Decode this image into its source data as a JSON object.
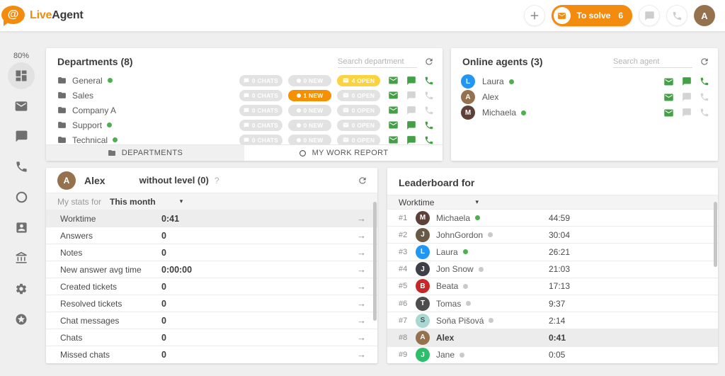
{
  "colors": {
    "brand_orange": "#F28B0E",
    "chip_grey": "#E2E2E2",
    "chip_orange": "#F59100",
    "chip_yellow": "#FBD342",
    "action_green": "#43A047",
    "status_online_green": "#4CAF50",
    "status_away_grey": "#C9C9C9",
    "highlight_row": "#EDEDED",
    "avatar_laura_blue": "#2196F3",
    "avatar_alex_brown": "#96714E",
    "avatar_michaela_darkbrown": "#5D4037",
    "avatar_beata_red": "#C62828",
    "avatar_jane_green": "#2DBE6C"
  },
  "topbar": {
    "logo": {
      "at": "@",
      "live": "Live",
      "agent": "Agent"
    },
    "to_solve": {
      "label": "To solve",
      "count": "6"
    },
    "avatar_initial": "A",
    "icons": [
      "add-circle-icon",
      "mail-icon",
      "chat-icon",
      "phone-icon"
    ]
  },
  "sidebar": {
    "percent": "80%",
    "items": [
      "dashboard",
      "tickets",
      "chats",
      "calls",
      "history",
      "contacts",
      "portal",
      "settings",
      "rewards"
    ]
  },
  "departments_panel": {
    "title": "Departments (8)",
    "search_placeholder": "Search department",
    "rows": [
      {
        "name": "General",
        "status": "online",
        "chats": "0 CHATS",
        "chats_variant": "grey",
        "new": "0 NEW",
        "new_variant": "grey",
        "open": "4 OPEN",
        "open_variant": "yellow",
        "mail": "on",
        "chat": "on",
        "phone": "on"
      },
      {
        "name": "Sales",
        "status": "none",
        "chats": "0 CHATS",
        "chats_variant": "grey",
        "new": "1 NEW",
        "new_variant": "orange",
        "open": "0 OPEN",
        "open_variant": "grey",
        "mail": "on",
        "chat": "off",
        "phone": "off"
      },
      {
        "name": "Company A",
        "status": "none",
        "chats": "0 CHATS",
        "chats_variant": "grey",
        "new": "0 NEW",
        "new_variant": "grey",
        "open": "0 OPEN",
        "open_variant": "grey",
        "mail": "on",
        "chat": "off",
        "phone": "off"
      },
      {
        "name": "Support",
        "status": "online",
        "chats": "0 CHATS",
        "chats_variant": "grey",
        "new": "0 NEW",
        "new_variant": "grey",
        "open": "0 OPEN",
        "open_variant": "grey",
        "mail": "on",
        "chat": "on",
        "phone": "on"
      },
      {
        "name": "Technical",
        "status": "online",
        "chats": "0 CHATS",
        "chats_variant": "grey",
        "new": "0 NEW",
        "new_variant": "grey",
        "open": "0 OPEN",
        "open_variant": "grey",
        "mail": "on",
        "chat": "on",
        "phone": "on"
      }
    ],
    "tabs": [
      {
        "label": "DEPARTMENTS",
        "icon": "folder-icon",
        "active": true
      },
      {
        "label": "MY WORK REPORT",
        "icon": "ring-icon",
        "active": false
      }
    ]
  },
  "agents_panel": {
    "title": "Online agents (3)",
    "search_placeholder": "Search agent",
    "rows": [
      {
        "name": "Laura",
        "initial": "L",
        "status": "online",
        "mail": "on",
        "chat": "on",
        "phone": "on"
      },
      {
        "name": "Alex",
        "initial": "A",
        "status": "none",
        "mail": "on",
        "chat": "off",
        "phone": "off"
      },
      {
        "name": "Michaela",
        "initial": "M",
        "status": "online",
        "mail": "on",
        "chat": "off",
        "phone": "off"
      }
    ]
  },
  "stats_panel": {
    "agent_name": "Alex",
    "avatar_initial": "A",
    "level_label": "without level (0)",
    "help": "?",
    "filter_label": "My stats for",
    "filter_value": "This month",
    "caret": "▾",
    "arrow": "→",
    "rows": [
      {
        "label": "Worktime",
        "value": "0:41",
        "highlight": true
      },
      {
        "label": "Answers",
        "value": "0",
        "highlight": false
      },
      {
        "label": "Notes",
        "value": "0",
        "highlight": false
      },
      {
        "label": "New answer avg time",
        "value": "0:00:00",
        "highlight": false
      },
      {
        "label": "Created tickets",
        "value": "0",
        "highlight": false
      },
      {
        "label": "Resolved tickets",
        "value": "0",
        "highlight": false
      },
      {
        "label": "Chat messages",
        "value": "0",
        "highlight": false
      },
      {
        "label": "Chats",
        "value": "0",
        "highlight": false
      },
      {
        "label": "Missed chats",
        "value": "0",
        "highlight": false
      }
    ]
  },
  "leaderboard_panel": {
    "title": "Leaderboard for",
    "metric": "Worktime",
    "caret": "▾",
    "rows": [
      {
        "rank": "#1",
        "name": "Michaela",
        "initial": "M",
        "status": "online",
        "value": "44:59",
        "highlight": false
      },
      {
        "rank": "#2",
        "name": "JohnGordon",
        "initial": "J",
        "status": "away",
        "value": "30:04",
        "highlight": false
      },
      {
        "rank": "#3",
        "name": "Laura",
        "initial": "L",
        "status": "online",
        "value": "26:21",
        "highlight": false
      },
      {
        "rank": "#4",
        "name": "Jon Snow",
        "initial": "J",
        "status": "away",
        "value": "21:03",
        "highlight": false
      },
      {
        "rank": "#5",
        "name": "Beata",
        "initial": "B",
        "status": "away",
        "value": "17:13",
        "highlight": false
      },
      {
        "rank": "#6",
        "name": "Tomas",
        "initial": "T",
        "status": "away",
        "value": "9:37",
        "highlight": false
      },
      {
        "rank": "#7",
        "name": "Soňa Pišová",
        "initial": "S",
        "status": "away",
        "value": "2:14",
        "highlight": false
      },
      {
        "rank": "#8",
        "name": "Alex",
        "initial": "A",
        "status": "none",
        "value": "0:41",
        "highlight": true
      },
      {
        "rank": "#9",
        "name": "Jane",
        "initial": "J",
        "status": "away",
        "value": "0:05",
        "highlight": false
      }
    ]
  }
}
